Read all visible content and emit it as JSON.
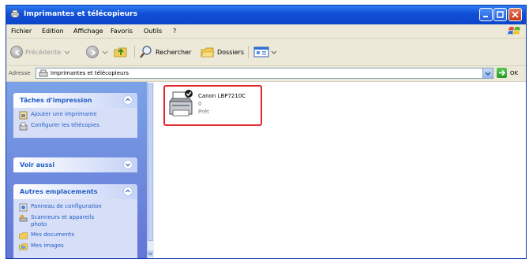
{
  "window": {
    "title": "Imprimantes et télécopieurs",
    "colors": {
      "titlebar": "#0f4fd6",
      "taskpane": "#6f8fe0",
      "highlight": "#e0282c"
    }
  },
  "menu": {
    "items": [
      "Fichier",
      "Edition",
      "Affichage",
      "Favoris",
      "Outils",
      "?"
    ]
  },
  "toolbar": {
    "back_label": "Précédente",
    "search_label": "Rechercher",
    "folders_label": "Dossiers"
  },
  "address": {
    "label": "Adresse",
    "value": "Imprimantes et télécopieurs",
    "go_label": "OK"
  },
  "taskpane": {
    "printer_tasks": {
      "title": "Tâches d'impression",
      "items": [
        {
          "label": "Ajouter une imprimante",
          "icon": "add-printer-icon"
        },
        {
          "label": "Configurer les télécopies",
          "icon": "fax-icon"
        }
      ]
    },
    "see_also": {
      "title": "Voir aussi"
    },
    "other_places": {
      "title": "Autres emplacements",
      "items": [
        {
          "label": "Panneau de configuration",
          "icon": "control-panel-icon"
        },
        {
          "label": "Scanneurs et appareils",
          "label2": "photo",
          "icon": "scanner-icon"
        },
        {
          "label": "Mes documents",
          "icon": "folder-icon"
        },
        {
          "label": "Mes images",
          "icon": "pictures-icon"
        }
      ]
    }
  },
  "printer": {
    "name": "Canon LBP7210C",
    "count": "0",
    "status": "Prêt",
    "icon": "printer-icon"
  }
}
